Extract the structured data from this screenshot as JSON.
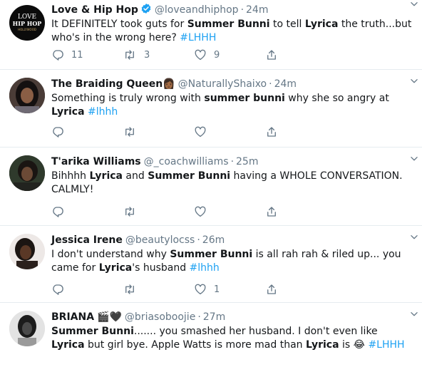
{
  "colors": {
    "name": "#14171a",
    "secondary": "#657786",
    "link": "#1da1f2",
    "verified": "#1da1f2",
    "divider": "#e6ecf0"
  },
  "tweets": [
    {
      "name": "Love & Hip Hop",
      "verified": true,
      "handle": "@loveandhiphop",
      "time": "24m",
      "avatar": {
        "icon": "love-hip-hop-hollywood-logo",
        "lines": [
          "LOVE",
          "HIP HOP",
          "HOLLYWOOD"
        ]
      },
      "segments": [
        {
          "t": "It DEFINITELY took guts for "
        },
        {
          "t": "Summer Bunni",
          "b": 1
        },
        {
          "t": " to tell "
        },
        {
          "t": "Lyrica",
          "b": 1
        },
        {
          "t": " the truth...but who's in the wrong here? "
        },
        {
          "t": "#LHHH",
          "h": 1
        }
      ],
      "actions": {
        "reply": "11",
        "retweet": "3",
        "like": "9"
      }
    },
    {
      "name": "The Braiding Queen",
      "name_emoji": "👩🏾",
      "handle": "@NaturallyShaixo",
      "time": "24m",
      "segments": [
        {
          "t": "Something is truly wrong with "
        },
        {
          "t": "summer bunni",
          "b": 1
        },
        {
          "t": " why she so angry at "
        },
        {
          "t": "Lyrica",
          "b": 1
        },
        {
          "t": " "
        },
        {
          "t": "#lhhh",
          "h": 1
        }
      ],
      "actions": {
        "reply": "",
        "retweet": "",
        "like": ""
      }
    },
    {
      "name": "T'arika Williams",
      "handle": "@_coachwilliams",
      "time": "25m",
      "segments": [
        {
          "t": "Bihhhh "
        },
        {
          "t": "Lyrica",
          "b": 1
        },
        {
          "t": " and "
        },
        {
          "t": "Summer Bunni",
          "b": 1
        },
        {
          "t": " having a WHOLE CONVERSATION. CALMLY!"
        }
      ],
      "actions": {
        "reply": "",
        "retweet": "",
        "like": ""
      }
    },
    {
      "name": "Jessica Irene",
      "handle": "@beautylocss",
      "time": "26m",
      "segments": [
        {
          "t": "I don't understand why "
        },
        {
          "t": "Summer Bunni",
          "b": 1
        },
        {
          "t": " is all rah rah & riled up... you came for "
        },
        {
          "t": "Lyrica",
          "b": 1
        },
        {
          "t": "'s husband "
        },
        {
          "t": "#lhhh",
          "h": 1
        }
      ],
      "actions": {
        "reply": "",
        "retweet": "",
        "like": "1"
      }
    },
    {
      "name": "BRIANA",
      "name_emoji": "🎬🖤",
      "handle": "@briasoboojie",
      "time": "27m",
      "segments": [
        {
          "t": "Summer Bunni",
          "b": 1
        },
        {
          "t": "....... you smashed her husband. I don't even like "
        },
        {
          "t": "Lyrica",
          "b": 1
        },
        {
          "t": " but girl bye. Apple Watts is more mad than "
        },
        {
          "t": "Lyrica",
          "b": 1
        },
        {
          "t": " is "
        },
        {
          "t": "😂",
          "e": 1
        },
        {
          "t": " "
        },
        {
          "t": "#LHHH",
          "h": 1
        }
      ],
      "actions": {
        "reply": "",
        "retweet": "",
        "like": ""
      }
    }
  ]
}
